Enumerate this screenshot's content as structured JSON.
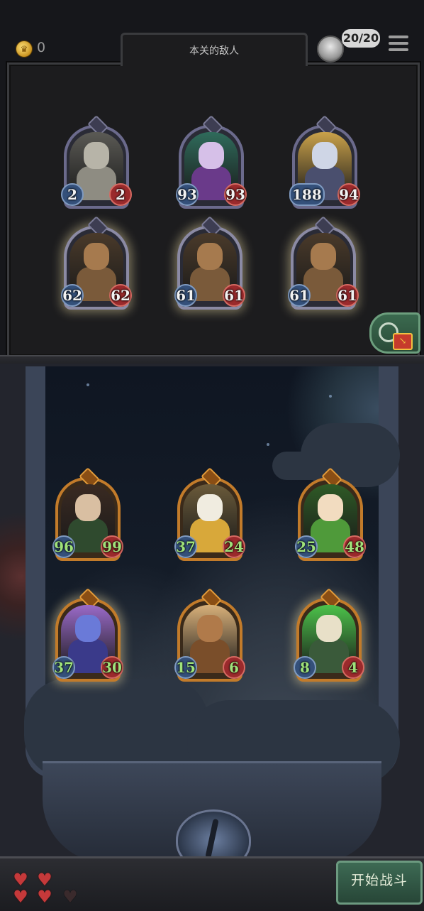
{
  "header": {
    "coins": "0",
    "panel_title": "本关的敌人",
    "life": "20/20"
  },
  "enemies": [
    {
      "atk": "2",
      "hp": "2",
      "glow": false,
      "art": "sailor-enemy"
    },
    {
      "atk": "93",
      "hp": "93",
      "glow": false,
      "art": "witch-enemy"
    },
    {
      "atk": "188",
      "hp": "94",
      "glow": false,
      "art": "brawler-enemy"
    },
    {
      "atk": "62",
      "hp": "62",
      "glow": true,
      "art": "bucket-head-enemy"
    },
    {
      "atk": "61",
      "hp": "61",
      "glow": true,
      "art": "bucket-head-enemy"
    },
    {
      "atk": "61",
      "hp": "61",
      "glow": true,
      "art": "bucket-head-enemy"
    }
  ],
  "heroes": [
    {
      "atk": "96",
      "hp": "99",
      "glow": false,
      "art": "old-witch-hero"
    },
    {
      "atk": "37",
      "hp": "24",
      "glow": false,
      "art": "eagle-hero"
    },
    {
      "atk": "25",
      "hp": "48",
      "glow": false,
      "art": "leaf-sprite-hero"
    },
    {
      "atk": "37",
      "hp": "30",
      "glow": true,
      "art": "dragon-hero"
    },
    {
      "atk": "15",
      "hp": "6",
      "glow": false,
      "art": "bear-hero"
    },
    {
      "atk": "8",
      "hp": "4",
      "glow": true,
      "art": "skeleton-hero"
    }
  ],
  "lives_hearts": [
    true,
    true,
    true,
    true,
    false
  ],
  "start_button": "开始战斗",
  "colors": {
    "enemy_frame": "#6b6a8c",
    "hero_frame": "#c27b2a",
    "hero_stat_text": "#9fe27a",
    "attack_badge": "#34507a",
    "health_badge": "#9a2a2c",
    "start_button": "#3d6a54"
  }
}
